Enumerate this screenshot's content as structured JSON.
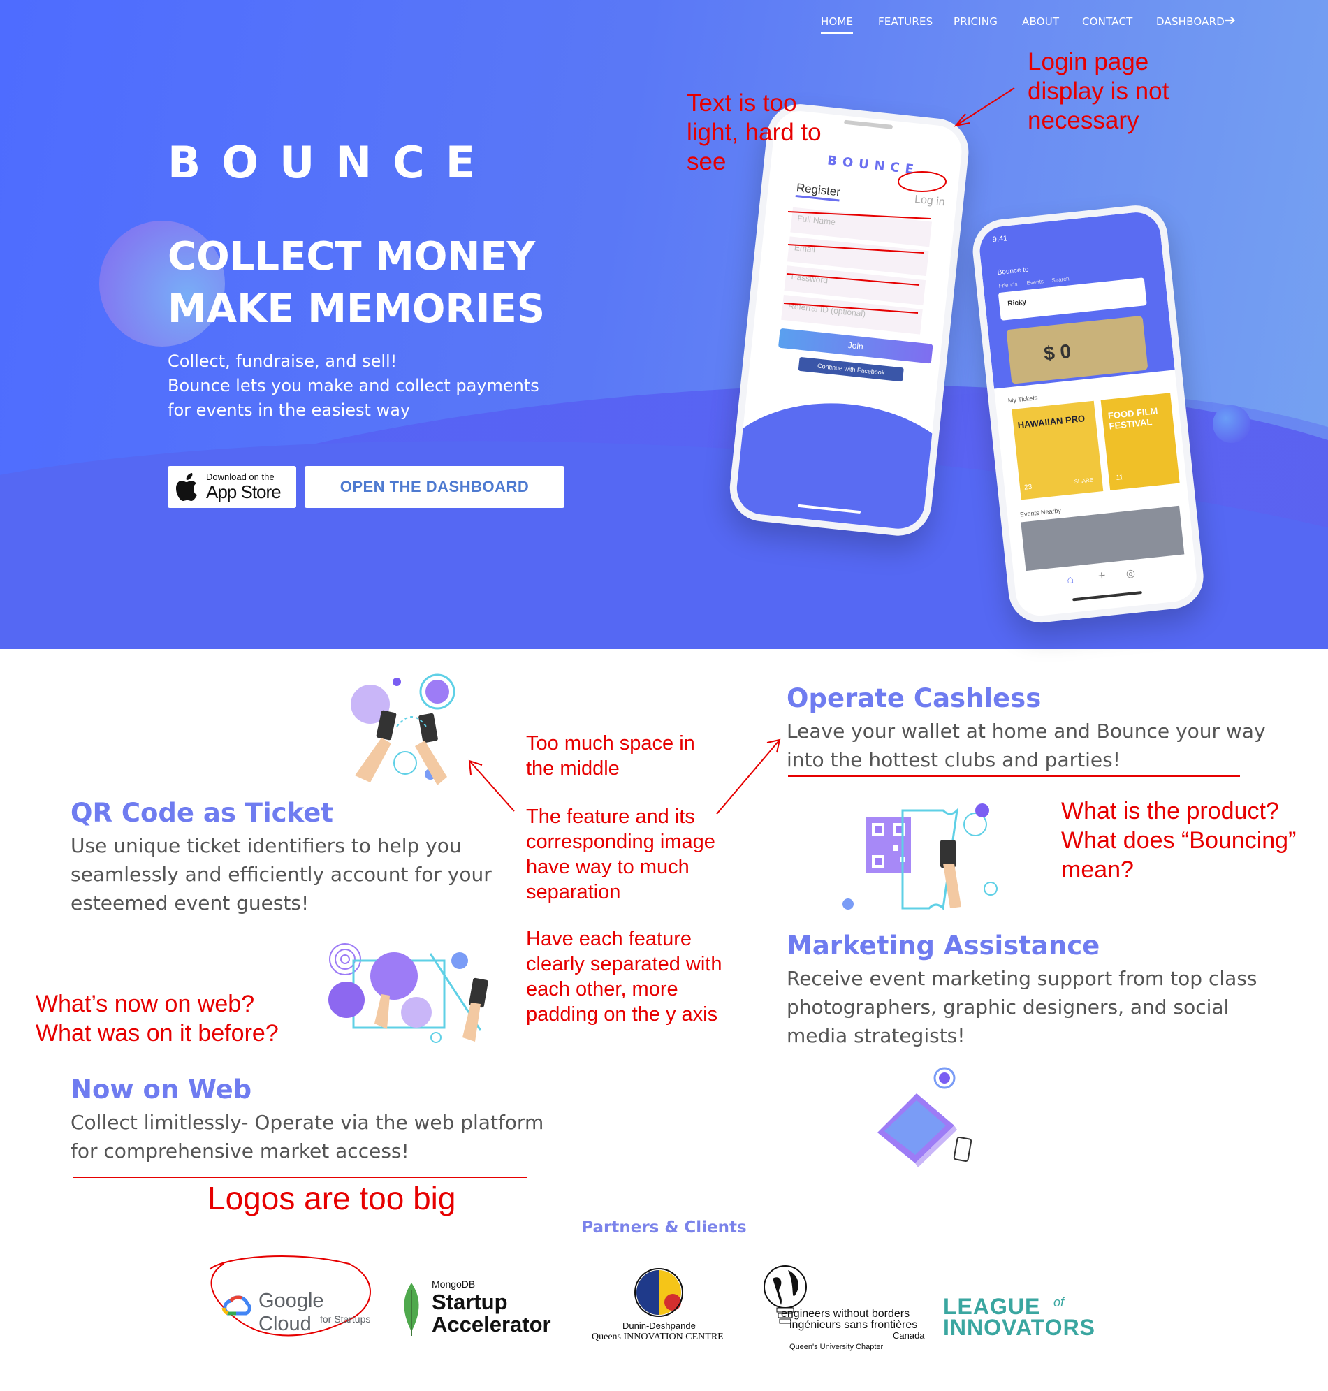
{
  "nav": {
    "items": [
      "HOME",
      "FEATURES",
      "PRICING",
      "ABOUT",
      "CONTACT",
      "DASHBOARD"
    ],
    "active": "HOME",
    "dashboard_icon": "arrow-right-icon"
  },
  "hero": {
    "logo": "BOUNCE",
    "headline_1": "COLLECT MONEY",
    "headline_2": "MAKE MEMORIES",
    "sub_1": "Collect, fundraise, and sell!",
    "sub_2": "Bounce lets you make and collect payments",
    "sub_3": "for events in the easiest way",
    "appstore_small": "Download on the",
    "appstore_big": "App Store",
    "dashboard_button": "OPEN THE DASHBOARD"
  },
  "phone_left": {
    "logo": "BOUNCE",
    "register": "Register",
    "login": "Log in",
    "fields": [
      "Full Name",
      "Email",
      "Password",
      "Referral ID (optional)"
    ],
    "join": "Join",
    "facebook": "Continue with Facebook"
  },
  "phone_right": {
    "time": "9:41",
    "bounce_to": "Bounce to",
    "tabs": [
      "Friends",
      "Events",
      "Search"
    ],
    "select_value": "Ricky",
    "amount": "$ 0",
    "my_tickets": "My Tickets",
    "ticket_1": "HAWAIIAN PRO",
    "ticket_1_count": "23",
    "ticket_1_share": "SHARE",
    "ticket_2": "FOOD FILM FESTIVAL",
    "ticket_2_count": "11",
    "events_nearby": "Events Nearby"
  },
  "features": [
    {
      "title": "QR Code as Ticket",
      "lines": [
        "Use unique ticket identifiers to help you",
        "seamlessly and efficiently account for your",
        "esteemed event guests!"
      ]
    },
    {
      "title": "Now on Web",
      "lines": [
        "Collect limitlessly- Operate via the web platform",
        "for comprehensive market access!"
      ]
    },
    {
      "title": "Operate Cashless",
      "lines": [
        "Leave your wallet at home and Bounce your way",
        "into the hottest clubs and parties!"
      ]
    },
    {
      "title": "Marketing Assistance",
      "lines": [
        "Receive event marketing support from top class",
        "photographers, graphic designers, and social",
        "media strategists!"
      ]
    }
  ],
  "partners": {
    "title": "Partners & Clients",
    "google": "Google Cloud",
    "google_sub": "for Startups",
    "mongo_small": "MongoDB",
    "mongo_1": "Startup",
    "mongo_2": "Accelerator",
    "dd_1": "Dunin-Deshpande",
    "dd_2": "Queens INNOVATION CENTRE",
    "ewb_1": "engineers without borders",
    "ewb_2": "ingénieurs sans frontières",
    "ewb_3": "Canada",
    "ewb_4": "Queen's University Chapter",
    "loi_1": "LEAGUE",
    "loi_of": "of",
    "loi_2": "INNOVATORS"
  },
  "annotations": {
    "login": [
      "Login page",
      "display is not",
      "necessary"
    ],
    "text_light": [
      "Text is too",
      "light, hard to",
      "see"
    ],
    "space": [
      "Too much space in",
      "the middle"
    ],
    "separation": [
      "The feature and its",
      "corresponding image",
      "have way to much",
      "separation"
    ],
    "padding": [
      "Have each feature",
      "clearly separated with",
      "each other, more",
      "padding on the y axis"
    ],
    "product": [
      "What is the product?",
      "What does “Bouncing”",
      "mean?"
    ],
    "web": [
      "What’s now on web?",
      "What was on it before?"
    ],
    "logos": "Logos are too big"
  },
  "colors": {
    "hero_start": "#4e6cff",
    "hero_end": "#76a3f1",
    "feature_title": "#6f7cf0",
    "annotation": "#e60000",
    "partners_title": "#7b83ea"
  }
}
